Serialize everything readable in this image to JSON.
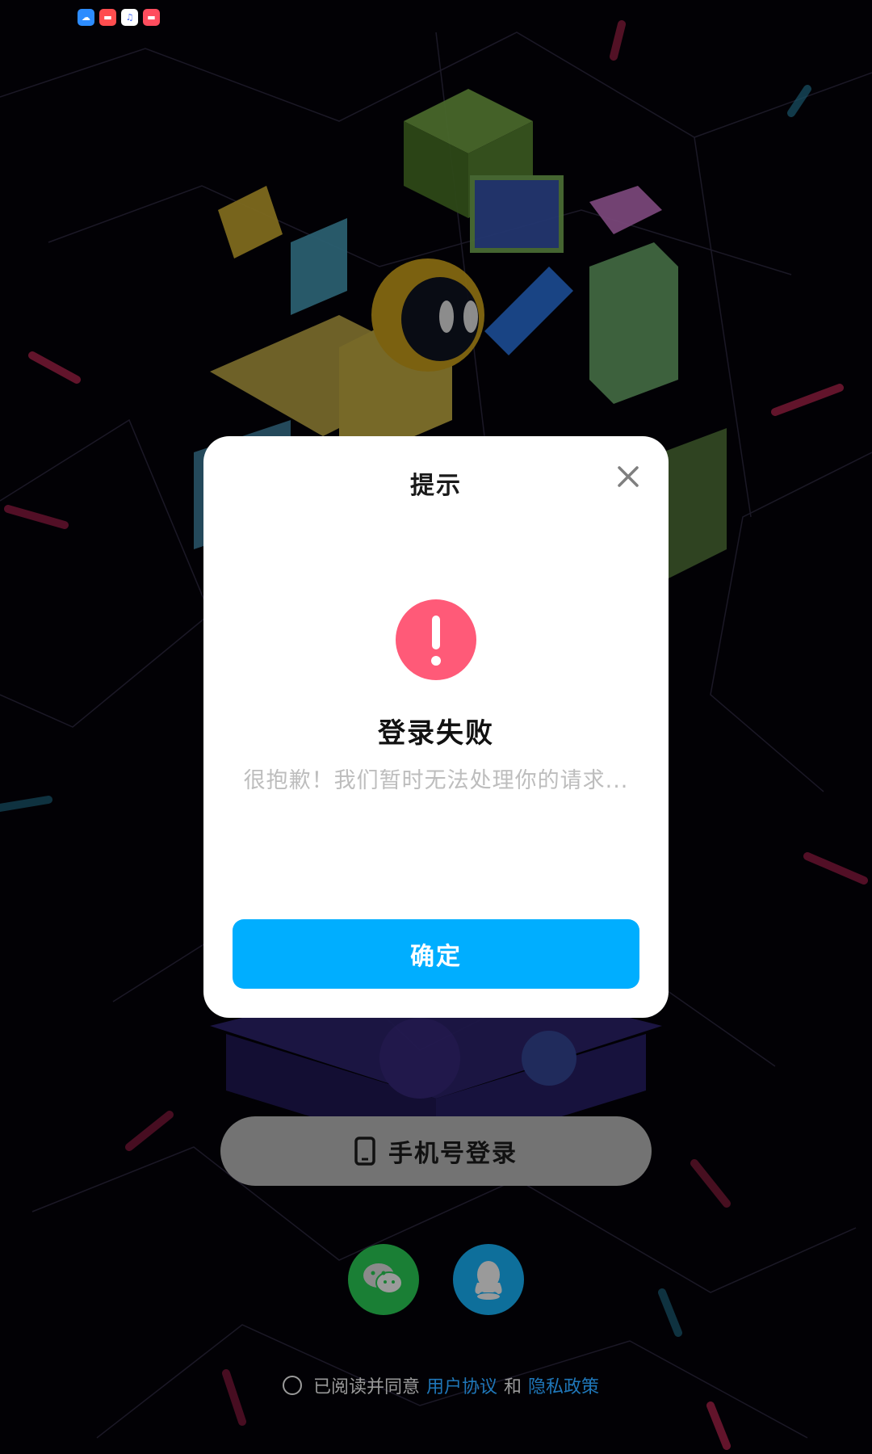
{
  "status_bar": {
    "icons": [
      "weather-icon",
      "app-red-icon",
      "music-icon",
      "app-red-icon"
    ]
  },
  "dialog": {
    "title": "提示",
    "heading": "登录失败",
    "message": "很抱歉！我们暂时无法处理你的请求...",
    "confirm_label": "确定",
    "alert_color": "#ff5a78",
    "confirm_color": "#00aeff"
  },
  "login": {
    "phone_login_label": "手机号登录",
    "social": [
      "wechat-icon",
      "qq-icon"
    ]
  },
  "agreement": {
    "prefix": "已阅读并同意",
    "user_agreement": "用户协议",
    "conjunction": "和",
    "privacy_policy": "隐私政策"
  }
}
